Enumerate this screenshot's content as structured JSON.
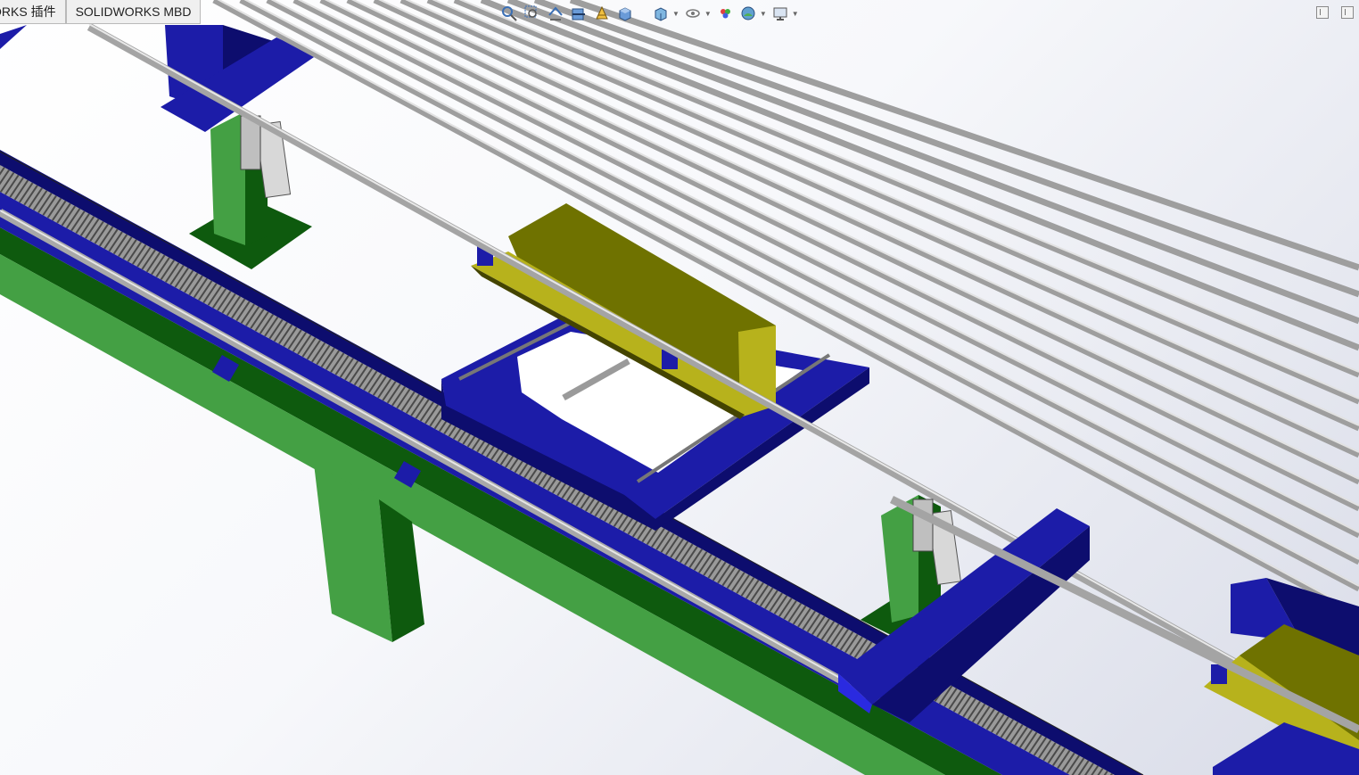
{
  "window": {
    "tabs": [
      {
        "label": "ORKS 插件"
      },
      {
        "label": "SOLIDWORKS MBD"
      }
    ]
  },
  "heads_up_toolbar": {
    "buttons": [
      {
        "name": "zoom-to-fit-icon"
      },
      {
        "name": "zoom-to-area-icon"
      },
      {
        "name": "previous-view-icon"
      },
      {
        "name": "section-view-icon"
      },
      {
        "name": "dynamic-annotation-icon"
      },
      {
        "name": "view-orientation-icon"
      },
      {
        "name": "display-style-icon"
      },
      {
        "name": "hide-show-items-icon"
      },
      {
        "name": "edit-appearance-icon"
      },
      {
        "name": "apply-scene-icon"
      },
      {
        "name": "view-settings-icon"
      }
    ]
  },
  "colors": {
    "frame_blue": "#1c1ca8",
    "frame_blue_dark": "#0d0d6e",
    "support_green": "#44a044",
    "support_green_dark": "#0e5a0e",
    "carriage_olive": "#6f7200",
    "carriage_olive_light": "#b7b21c",
    "rod_gray": "#b8b8b8",
    "rack_gray": "#8d8d8d"
  }
}
